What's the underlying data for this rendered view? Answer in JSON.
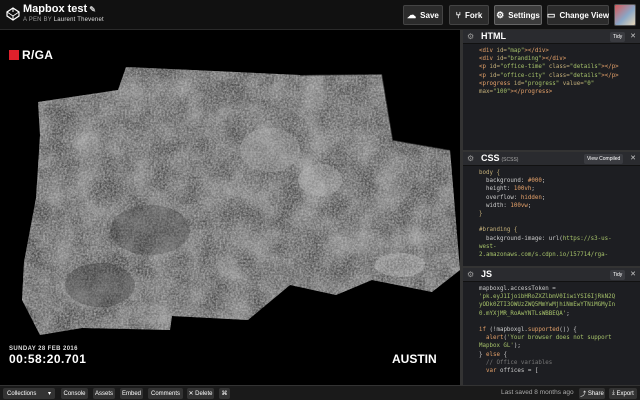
{
  "header": {
    "pen_title": "Mapbox test",
    "byline_prefix": "A PEN BY",
    "author": "Laurent Thevenet",
    "buttons": {
      "save": "Save",
      "fork": "Fork",
      "settings": "Settings",
      "change_view": "Change View"
    }
  },
  "preview": {
    "branding": "R/GA",
    "brand_color": "#e0202b",
    "date": "SUNDAY 28 FEB 2016",
    "time": "00:58:20.701",
    "city": "AUSTIN"
  },
  "html_panel": {
    "title": "HTML",
    "tidy": "Tidy",
    "lines": [
      [
        {
          "c": "t-tag",
          "t": "<div "
        },
        {
          "c": "t-attr",
          "t": "id="
        },
        {
          "c": "t-str",
          "t": "\"map\""
        },
        {
          "c": "t-tag",
          "t": "></div>"
        }
      ],
      [
        {
          "c": "t-tag",
          "t": "<div "
        },
        {
          "c": "t-attr",
          "t": "id="
        },
        {
          "c": "t-str",
          "t": "\"branding\""
        },
        {
          "c": "t-tag",
          "t": "></div>"
        }
      ],
      [
        {
          "c": "t-tag",
          "t": "<p "
        },
        {
          "c": "t-attr",
          "t": "id="
        },
        {
          "c": "t-str",
          "t": "\"office-time\" "
        },
        {
          "c": "t-attr",
          "t": "class="
        },
        {
          "c": "t-str",
          "t": "\"details\""
        },
        {
          "c": "t-tag",
          "t": "></p>"
        }
      ],
      [
        {
          "c": "t-tag",
          "t": "<p "
        },
        {
          "c": "t-attr",
          "t": "id="
        },
        {
          "c": "t-str",
          "t": "\"office-city\" "
        },
        {
          "c": "t-attr",
          "t": "class="
        },
        {
          "c": "t-str",
          "t": "\"details\""
        },
        {
          "c": "t-tag",
          "t": "></p>"
        }
      ],
      [
        {
          "c": "t-tag",
          "t": "<progress "
        },
        {
          "c": "t-attr",
          "t": "id="
        },
        {
          "c": "t-str",
          "t": "\"progress\" "
        },
        {
          "c": "t-attr",
          "t": "value="
        },
        {
          "c": "t-str",
          "t": "\"0\""
        }
      ],
      [
        {
          "c": "t-attr",
          "t": "max="
        },
        {
          "c": "t-str",
          "t": "\"100\""
        },
        {
          "c": "t-tag",
          "t": "></progress>"
        }
      ]
    ]
  },
  "css_panel": {
    "title": "CSS",
    "subtitle": "(SCSS)",
    "view_compiled": "View Compiled",
    "lines": [
      [
        {
          "c": "t-sel",
          "t": "body {"
        }
      ],
      [
        {
          "c": "t-prop",
          "t": "  background: "
        },
        {
          "c": "t-val",
          "t": "#000"
        },
        {
          "c": "t-prop",
          "t": ";"
        }
      ],
      [
        {
          "c": "t-prop",
          "t": "  height: "
        },
        {
          "c": "t-val",
          "t": "100vh"
        },
        {
          "c": "t-prop",
          "t": ";"
        }
      ],
      [
        {
          "c": "t-prop",
          "t": "  overflow: "
        },
        {
          "c": "t-val",
          "t": "hidden"
        },
        {
          "c": "t-prop",
          "t": ";"
        }
      ],
      [
        {
          "c": "t-prop",
          "t": "  width: "
        },
        {
          "c": "t-val",
          "t": "100vw"
        },
        {
          "c": "t-prop",
          "t": ";"
        }
      ],
      [
        {
          "c": "t-sel",
          "t": "}"
        }
      ],
      [
        {
          "c": "t-prop",
          "t": ""
        }
      ],
      [
        {
          "c": "t-sel",
          "t": "#branding {"
        }
      ],
      [
        {
          "c": "t-prop",
          "t": "  background-image: url("
        },
        {
          "c": "t-str",
          "t": "https://s3-us-"
        }
      ],
      [
        {
          "c": "t-str",
          "t": "west-"
        }
      ],
      [
        {
          "c": "t-str",
          "t": "2.amazonaws.com/s.cdpn.io/157714/rga-"
        }
      ]
    ]
  },
  "js_panel": {
    "title": "JS",
    "tidy": "Tidy",
    "lines": [
      [
        {
          "c": "t-prop",
          "t": "mapboxgl.accessToken ="
        }
      ],
      [
        {
          "c": "t-str",
          "t": "'pk.eyJ1IjoibHRoZXZlbmV0IiwiYSI6IjRkN2Q"
        }
      ],
      [
        {
          "c": "t-str",
          "t": "yODk0ZTI3OWUzZWQ5MmYwMjhiNmEwYTNiMGMyIn"
        }
      ],
      [
        {
          "c": "t-str",
          "t": "0.mYXjMR_RoAwYNTLsWBBEQA'"
        },
        {
          "c": "t-prop",
          "t": ";"
        }
      ],
      [
        {
          "c": "t-prop",
          "t": ""
        }
      ],
      [
        {
          "c": "t-kw",
          "t": "if "
        },
        {
          "c": "t-prop",
          "t": "(!mapboxgl."
        },
        {
          "c": "t-fn",
          "t": "supported"
        },
        {
          "c": "t-prop",
          "t": "()) {"
        }
      ],
      [
        {
          "c": "t-fn",
          "t": "  alert"
        },
        {
          "c": "t-prop",
          "t": "("
        },
        {
          "c": "t-str",
          "t": "'Your browser does not support"
        }
      ],
      [
        {
          "c": "t-str",
          "t": "Mapbox GL'"
        },
        {
          "c": "t-prop",
          "t": ");"
        }
      ],
      [
        {
          "c": "t-prop",
          "t": "} "
        },
        {
          "c": "t-kw",
          "t": "else"
        },
        {
          "c": "t-prop",
          "t": " {"
        }
      ],
      [
        {
          "c": "t-cm",
          "t": "  // Office variables"
        }
      ],
      [
        {
          "c": "t-kw",
          "t": "  var "
        },
        {
          "c": "t-prop",
          "t": "offices = ["
        }
      ]
    ]
  },
  "bottom": {
    "collections": "Collections",
    "console": "Console",
    "assets": "Assets",
    "embed": "Embed",
    "comments": "Comments",
    "delete": "Delete",
    "saved": "Last saved 8 months ago",
    "share": "Share",
    "export": "Export"
  }
}
